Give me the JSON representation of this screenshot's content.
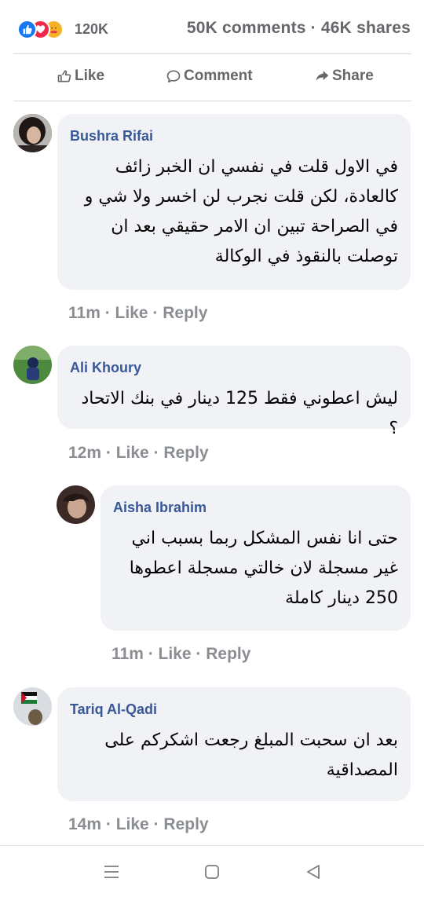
{
  "stats": {
    "reactions_count": "120K",
    "comments_shares": "50K comments · 46K shares",
    "reaction_icons": [
      "like-icon",
      "love-icon",
      "care-icon"
    ]
  },
  "actions": {
    "like": "Like",
    "comment": "Comment",
    "share": "Share"
  },
  "comments": [
    {
      "name": "Bushra Rifai",
      "text": "في الاول قلت في نفسي ان الخبر زائف كالعادة، لكن قلت نجرب لن اخسر ولا شي و في الصراحة تبين ان الامر حقيقي بعد ان توصلت بالنقوذ في الوكالة",
      "time": "11m",
      "like": "Like",
      "reply": "Reply"
    },
    {
      "name": "Ali Khoury",
      "text": "ليش اعطوني فقط 125 دينار في بنك الاتحاد ؟",
      "time": "12m",
      "like": "Like",
      "reply": "Reply"
    },
    {
      "name": "Aisha Ibrahim",
      "text": "حتى انا نفس المشكل ربما بسبب اني غير مسجلة لان خالتي مسجلة اعطوها 250 دينار كاملة",
      "time": "11m",
      "like": "Like",
      "reply": "Reply"
    },
    {
      "name": "Tariq Al-Qadi",
      "text": "بعد ان سحبت المبلغ رجعت اشكركم على المصداقية",
      "time": "14m",
      "like": "Like",
      "reply": "Reply"
    }
  ],
  "colors": {
    "name": "#385898",
    "meta": "#8a8d91",
    "bubble": "#f0f2f5"
  }
}
